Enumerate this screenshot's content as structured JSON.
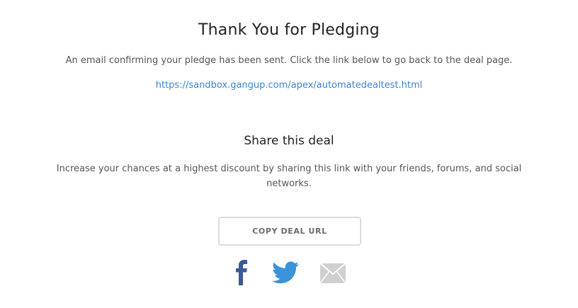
{
  "confirmation": {
    "title": "Thank You for Pledging",
    "message": "An email confirming your pledge has been sent. Click the link below to go back to the deal page.",
    "deal_link": "https://sandbox.gangup.com/apex/automatedealtest.html"
  },
  "share": {
    "title": "Share this deal",
    "description": "Increase your chances at a highest discount by sharing this link with your friends, forums, and social networks.",
    "copy_button_label": "COPY DEAL URL",
    "icons": [
      "facebook-icon",
      "twitter-icon",
      "email-icon"
    ]
  },
  "colors": {
    "link": "#3b85d0",
    "facebook": "#3b5998",
    "twitter": "#3b94d9",
    "email": "#c8c8c8"
  }
}
